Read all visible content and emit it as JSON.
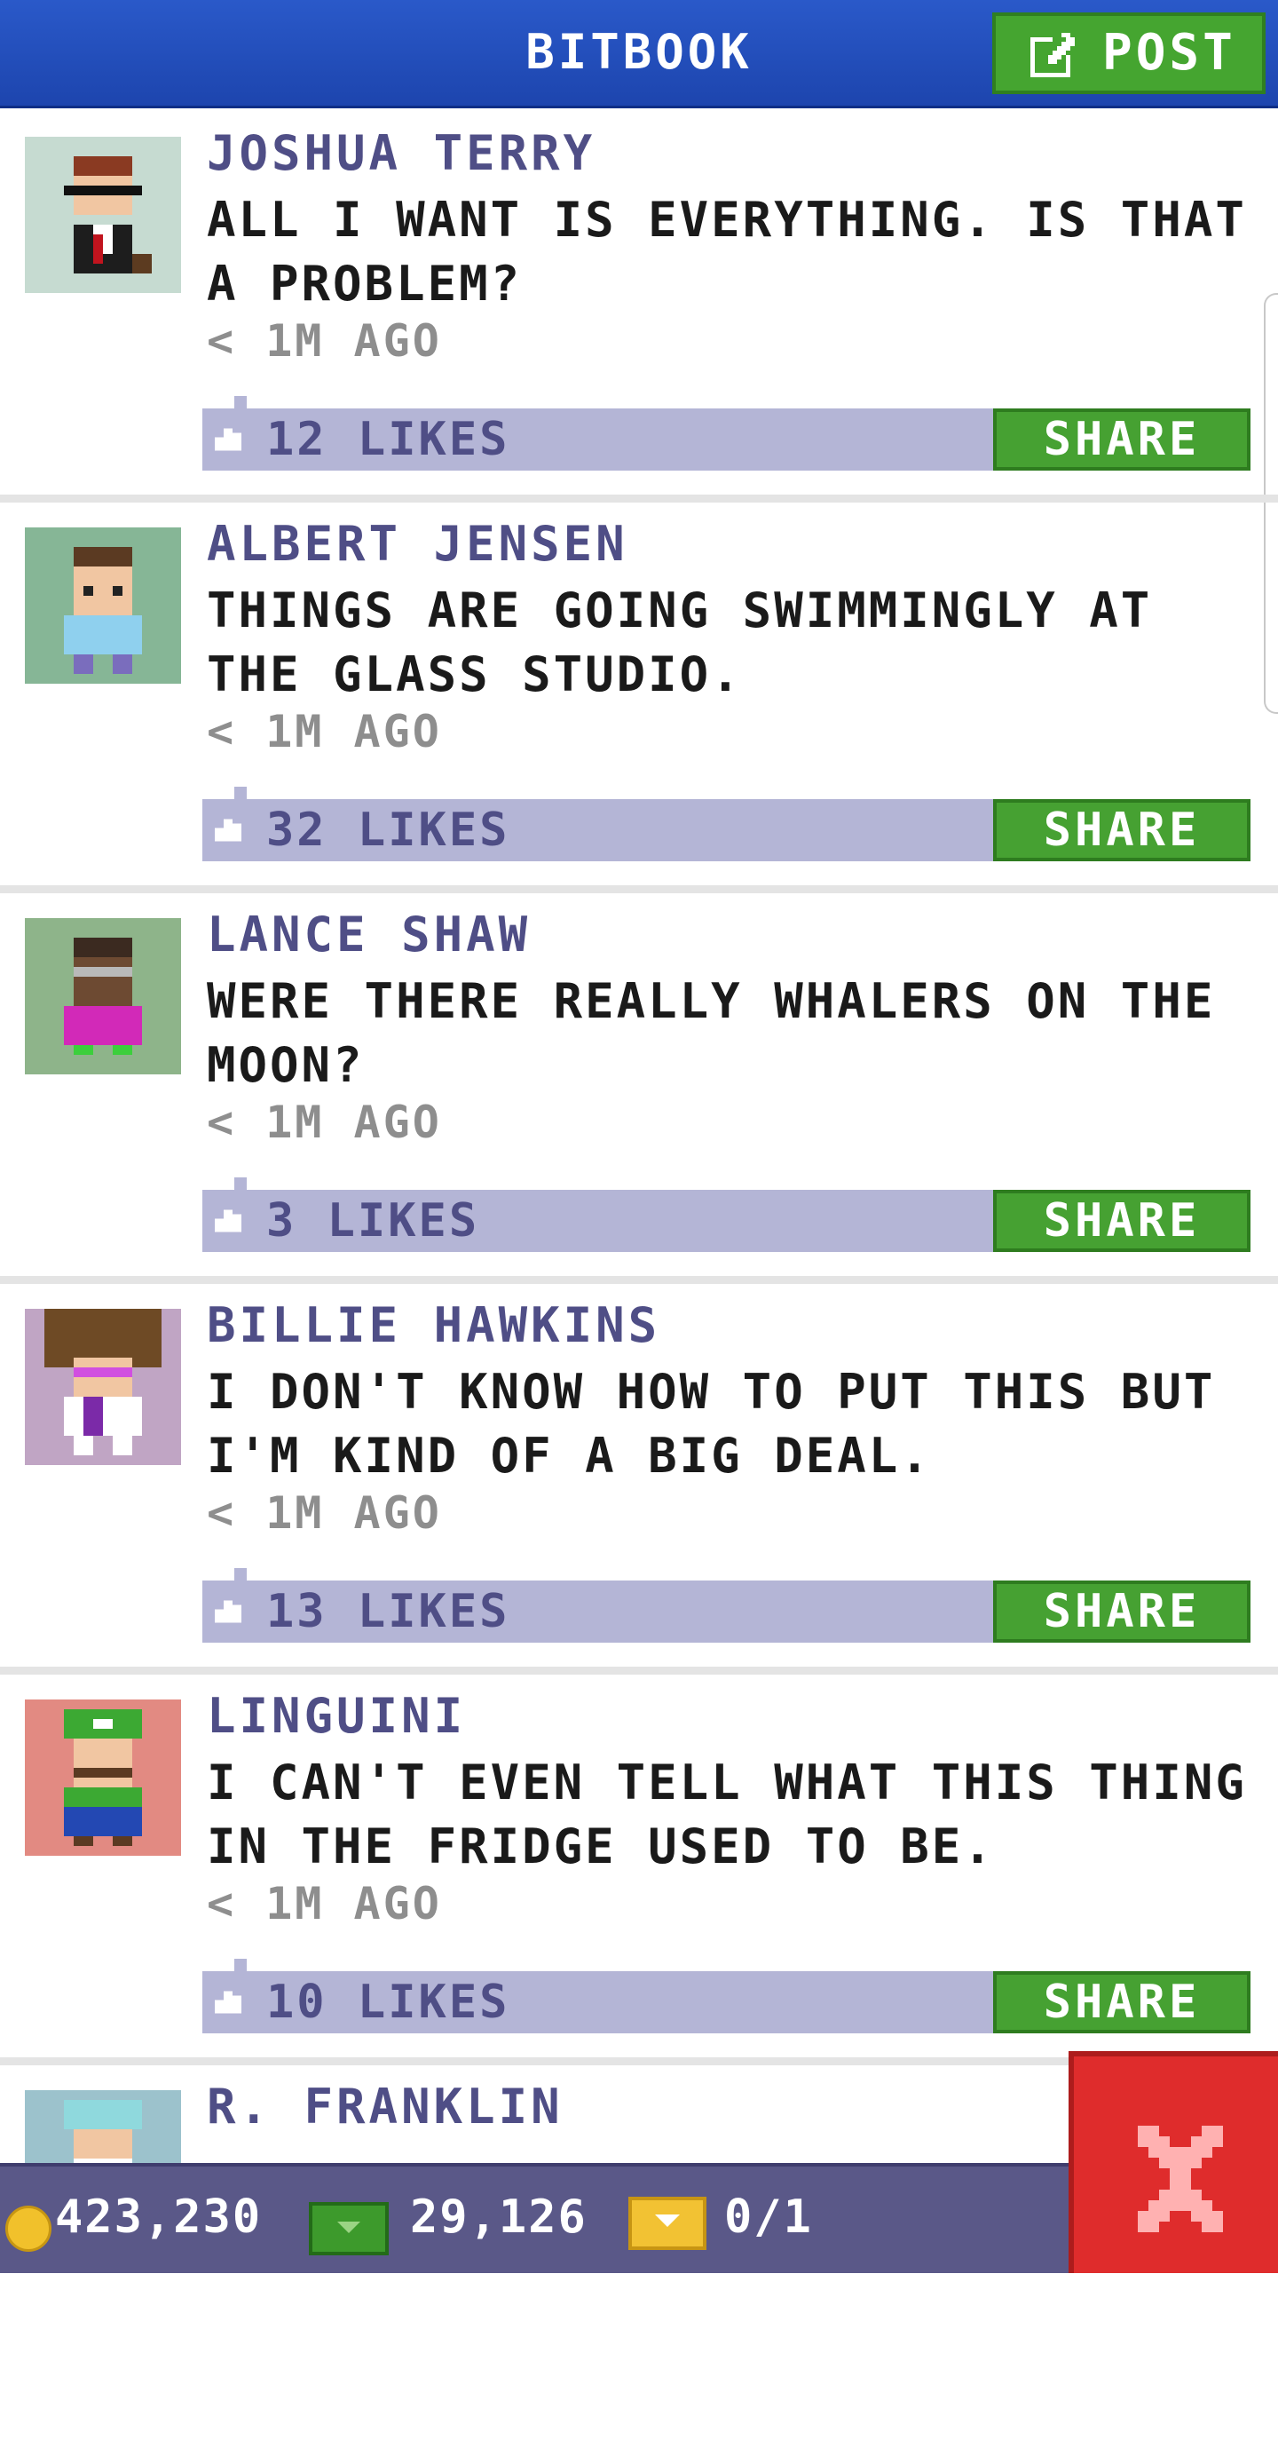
{
  "header": {
    "title": "BITBOOK",
    "post_label": "POST"
  },
  "posts": [
    {
      "name": "JOSHUA TERRY",
      "text": "ALL I WANT IS EVERYTHING. IS THAT A PROBLEM?",
      "time": "< 1M AGO",
      "likes": "12 LIKES",
      "share": "SHARE",
      "avatar_bg": "#c6dbd1"
    },
    {
      "name": "ALBERT JENSEN",
      "text": "THINGS ARE GOING SWIMMINGLY AT THE GLASS STUDIO.",
      "time": "< 1M AGO",
      "likes": "32 LIKES",
      "share": "SHARE",
      "avatar_bg": "#86b696"
    },
    {
      "name": "LANCE SHAW",
      "text": "WERE THERE REALLY WHALERS ON THE MOON?",
      "time": "< 1M AGO",
      "likes": "3 LIKES",
      "share": "SHARE",
      "avatar_bg": "#8eb48a"
    },
    {
      "name": "BILLIE HAWKINS",
      "text": "I DON'T KNOW HOW TO PUT THIS BUT I'M KIND OF A BIG DEAL.",
      "time": "< 1M AGO",
      "likes": "13 LIKES",
      "share": "SHARE",
      "avatar_bg": "#c0a5c4"
    },
    {
      "name": "LINGUINI",
      "text": "I CAN'T EVEN TELL WHAT THIS THING IN THE FRIDGE USED TO BE.",
      "time": "< 1M AGO",
      "likes": "10 LIKES",
      "share": "SHARE",
      "avatar_bg": "#e28a82"
    },
    {
      "name": "R. FRANKLIN",
      "avatar_bg": "#9cc2cc"
    }
  ],
  "status": {
    "coins": "423,230",
    "cash": "29,126",
    "tickets": "0/1"
  },
  "colors": {
    "header_blue": "#2a59c9",
    "share_green": "#46a132",
    "like_bar": "#b4b5d6",
    "name_purple": "#4f4e86",
    "close_red": "#df2c2c"
  },
  "icons": {
    "post": "edit-icon",
    "like": "like-icon",
    "close": "close-icon",
    "coin": "coin-icon",
    "cash": "cash-icon",
    "ticket": "ticket-icon"
  }
}
